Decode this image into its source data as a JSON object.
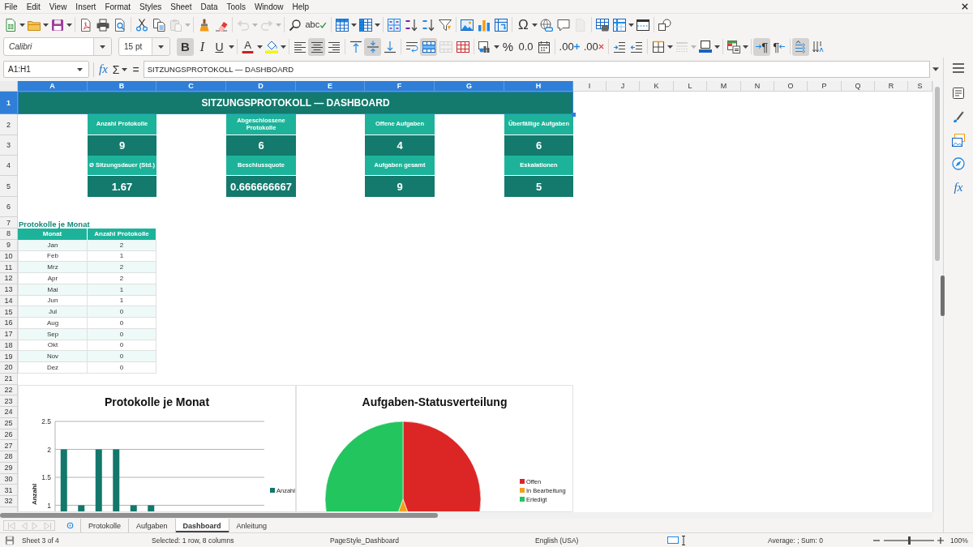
{
  "menu": [
    "File",
    "Edit",
    "View",
    "Insert",
    "Format",
    "Styles",
    "Sheet",
    "Data",
    "Tools",
    "Window",
    "Help"
  ],
  "toolbars": [
    {
      "items": [
        {
          "kind": "dropdown",
          "pressed": false,
          "disabled": false
        },
        {
          "kind": "dropdown",
          "pressed": false,
          "disabled": false
        },
        {
          "kind": "dropdown",
          "pressed": false,
          "disabled": false
        },
        {
          "kind": "separator"
        },
        {
          "kind": "button",
          "pressed": false,
          "disabled": false
        },
        {
          "kind": "button",
          "pressed": false,
          "disabled": false
        },
        {
          "kind": "button",
          "pressed": false,
          "disabled": false
        },
        {
          "kind": "separator"
        },
        {
          "kind": "button",
          "pressed": false,
          "disabled": false
        },
        {
          "kind": "button",
          "pressed": false,
          "disabled": false
        },
        {
          "kind": "dropdown",
          "pressed": false,
          "disabled": true
        },
        {
          "kind": "separator"
        },
        {
          "kind": "button",
          "pressed": false,
          "disabled": false
        },
        {
          "kind": "button",
          "pressed": false,
          "disabled": false
        },
        {
          "kind": "separator"
        },
        {
          "kind": "dropdown",
          "pressed": false,
          "disabled": true
        },
        {
          "kind": "dropdown",
          "pressed": false,
          "disabled": true
        },
        {
          "kind": "separator"
        },
        {
          "kind": "button",
          "pressed": false,
          "disabled": false
        },
        {
          "kind": "button",
          "label": "abc",
          "pressed": false,
          "disabled": false
        },
        {
          "kind": "separator"
        },
        {
          "kind": "dropdown",
          "pressed": false,
          "disabled": false
        },
        {
          "kind": "dropdown",
          "pressed": false,
          "disabled": false
        },
        {
          "kind": "separator"
        },
        {
          "kind": "button",
          "pressed": false,
          "disabled": false
        },
        {
          "kind": "button",
          "pressed": false,
          "disabled": false
        },
        {
          "kind": "button",
          "pressed": false,
          "disabled": false
        },
        {
          "kind": "button",
          "pressed": false,
          "disabled": false
        },
        {
          "kind": "separator"
        },
        {
          "kind": "button",
          "pressed": false,
          "disabled": false
        },
        {
          "kind": "button",
          "pressed": false,
          "disabled": false
        },
        {
          "kind": "button",
          "pressed": false,
          "disabled": false
        },
        {
          "kind": "separator"
        },
        {
          "kind": "dropdown",
          "label": "Ω",
          "pressed": false,
          "disabled": false
        },
        {
          "kind": "button",
          "pressed": false,
          "disabled": false
        },
        {
          "kind": "button",
          "pressed": false,
          "disabled": false
        },
        {
          "kind": "button",
          "pressed": false,
          "disabled": true
        },
        {
          "kind": "separator"
        },
        {
          "kind": "button",
          "pressed": false,
          "disabled": false
        },
        {
          "kind": "dropdown",
          "pressed": false,
          "disabled": false
        },
        {
          "kind": "button",
          "pressed": false,
          "disabled": false
        },
        {
          "kind": "separator"
        },
        {
          "kind": "button",
          "pressed": false,
          "disabled": false
        }
      ]
    },
    {
      "items": [
        {
          "kind": "fontbox",
          "value": "Calibri"
        },
        {
          "kind": "sizebox",
          "value": "15 pt"
        },
        {
          "kind": "button",
          "label": "B",
          "pressed": true,
          "disabled": false
        },
        {
          "kind": "button",
          "label": "I",
          "pressed": false,
          "disabled": false
        },
        {
          "kind": "dropdown",
          "label": "U",
          "pressed": false,
          "disabled": false
        },
        {
          "kind": "separator"
        },
        {
          "kind": "dropdown",
          "label": "A",
          "pressed": false,
          "disabled": false
        },
        {
          "kind": "dropdown",
          "pressed": false,
          "disabled": false
        },
        {
          "kind": "separator"
        },
        {
          "kind": "button",
          "pressed": false,
          "disabled": false
        },
        {
          "kind": "button",
          "pressed": true,
          "disabled": false
        },
        {
          "kind": "button",
          "pressed": false,
          "disabled": false
        },
        {
          "kind": "separator"
        },
        {
          "kind": "button",
          "pressed": false,
          "disabled": false
        },
        {
          "kind": "button",
          "pressed": true,
          "disabled": false
        },
        {
          "kind": "button",
          "pressed": false,
          "disabled": false
        },
        {
          "kind": "separator"
        },
        {
          "kind": "button",
          "pressed": false,
          "disabled": false
        },
        {
          "kind": "button",
          "pressed": true,
          "disabled": false
        },
        {
          "kind": "button",
          "pressed": false,
          "disabled": true
        },
        {
          "kind": "button",
          "pressed": false,
          "disabled": false
        },
        {
          "kind": "separator"
        },
        {
          "kind": "dropdown",
          "pressed": false,
          "disabled": false
        },
        {
          "kind": "button",
          "label": "%",
          "pressed": false,
          "disabled": false
        },
        {
          "kind": "button",
          "label": "0.0",
          "pressed": false,
          "disabled": false
        },
        {
          "kind": "button",
          "pressed": false,
          "disabled": false
        },
        {
          "kind": "separator"
        },
        {
          "kind": "button",
          "label": ".00",
          "pressed": false,
          "disabled": false
        },
        {
          "kind": "button",
          "label": ".00",
          "pressed": false,
          "disabled": false
        },
        {
          "kind": "separator"
        },
        {
          "kind": "button",
          "pressed": false,
          "disabled": false
        },
        {
          "kind": "button",
          "pressed": false,
          "disabled": false
        },
        {
          "kind": "separator"
        },
        {
          "kind": "dropdown",
          "pressed": false,
          "disabled": false
        },
        {
          "kind": "dropdown",
          "pressed": false,
          "disabled": true
        },
        {
          "kind": "dropdown",
          "pressed": false,
          "disabled": false
        },
        {
          "kind": "separator"
        },
        {
          "kind": "dropdown",
          "pressed": false,
          "disabled": false
        },
        {
          "kind": "separator"
        },
        {
          "kind": "button",
          "label": "¶",
          "pressed": true,
          "disabled": false
        },
        {
          "kind": "button",
          "label": "¶",
          "pressed": false,
          "disabled": false
        },
        {
          "kind": "separator"
        },
        {
          "kind": "button",
          "pressed": true,
          "disabled": false
        },
        {
          "kind": "button",
          "pressed": false,
          "disabled": false
        }
      ]
    }
  ],
  "formula_bar": {
    "name_box": "A1:H1",
    "wizard": "fx",
    "sum": "Σ",
    "equals": "=",
    "value": "SITZUNGSPROTOKOLL — DASHBOARD"
  },
  "sheet": {
    "columns": [
      {
        "label": "A",
        "selected": true
      },
      {
        "label": "B",
        "selected": true
      },
      {
        "label": "C",
        "selected": true
      },
      {
        "label": "D",
        "selected": true
      },
      {
        "label": "E",
        "selected": true
      },
      {
        "label": "F",
        "selected": true
      },
      {
        "label": "G",
        "selected": true
      },
      {
        "label": "H",
        "selected": true
      },
      {
        "label": "I",
        "selected": false
      },
      {
        "label": "J",
        "selected": false
      },
      {
        "label": "K",
        "selected": false
      },
      {
        "label": "L",
        "selected": false
      },
      {
        "label": "M",
        "selected": false
      },
      {
        "label": "N",
        "selected": false
      },
      {
        "label": "O",
        "selected": false
      },
      {
        "label": "P",
        "selected": false
      },
      {
        "label": "Q",
        "selected": false
      },
      {
        "label": "R",
        "selected": false
      },
      {
        "label": "S",
        "selected": false
      }
    ],
    "rows": [
      {
        "label": "1",
        "selected": true
      },
      {
        "label": "2",
        "selected": false
      },
      {
        "label": "3",
        "selected": false
      },
      {
        "label": "4",
        "selected": false
      },
      {
        "label": "5",
        "selected": false
      },
      {
        "label": "6",
        "selected": false
      },
      {
        "label": "7",
        "selected": false
      },
      {
        "label": "8",
        "selected": false
      },
      {
        "label": "9",
        "selected": false
      },
      {
        "label": "10",
        "selected": false
      },
      {
        "label": "11",
        "selected": false
      },
      {
        "label": "12",
        "selected": false
      },
      {
        "label": "13",
        "selected": false
      },
      {
        "label": "14",
        "selected": false
      },
      {
        "label": "15",
        "selected": false
      },
      {
        "label": "16",
        "selected": false
      },
      {
        "label": "17",
        "selected": false
      },
      {
        "label": "18",
        "selected": false
      },
      {
        "label": "19",
        "selected": false
      },
      {
        "label": "20",
        "selected": false
      },
      {
        "label": "21",
        "selected": false
      },
      {
        "label": "22",
        "selected": false
      },
      {
        "label": "23",
        "selected": false
      },
      {
        "label": "24",
        "selected": false
      },
      {
        "label": "25",
        "selected": false
      },
      {
        "label": "26",
        "selected": false
      },
      {
        "label": "27",
        "selected": false
      },
      {
        "label": "28",
        "selected": false
      },
      {
        "label": "29",
        "selected": false
      },
      {
        "label": "30",
        "selected": false
      },
      {
        "label": "31",
        "selected": false
      },
      {
        "label": "32",
        "selected": false
      }
    ],
    "title": {
      "text": "SITZUNGSPROTOKOLL — DASHBOARD",
      "selected": true
    },
    "kpis": [
      {
        "label": "Anzahl Protokolle",
        "value": "9"
      },
      {
        "label": "Abgeschlossene Protokolle",
        "value": "6"
      },
      {
        "label": "Offene Aufgaben",
        "value": "4"
      },
      {
        "label": "Überfällige Aufgaben",
        "value": "6"
      },
      {
        "label": "Ø Sitzungsdauer (Std.)",
        "value": "1.67"
      },
      {
        "label": "Beschlussquote",
        "value": "0.666666667"
      },
      {
        "label": "Aufgaben gesamt",
        "value": "9"
      },
      {
        "label": "Eskalationen",
        "value": "5"
      }
    ],
    "section_title": "Protokolle je Monat",
    "table": {
      "columns": [
        "Monat",
        "Anzahl Protokolle"
      ],
      "rows": [
        [
          "Jan",
          "2"
        ],
        [
          "Feb",
          "1"
        ],
        [
          "Mrz",
          "2"
        ],
        [
          "Apr",
          "2"
        ],
        [
          "Mai",
          "1"
        ],
        [
          "Jun",
          "1"
        ],
        [
          "Jul",
          "0"
        ],
        [
          "Aug",
          "0"
        ],
        [
          "Sep",
          "0"
        ],
        [
          "Okt",
          "0"
        ],
        [
          "Nov",
          "0"
        ],
        [
          "Dez",
          "0"
        ]
      ]
    },
    "charts": [
      {
        "chart_data": {
          "type": "bar",
          "title": "Protokolle je Monat",
          "ylabel": "Anzahl",
          "grid": true,
          "legend": "right",
          "series": [
            {
              "name": "Anzahl",
              "color": "#13776b",
              "values": [
                2,
                1,
                2,
                2,
                1,
                1,
                0,
                0,
                0,
                0,
                0,
                0
              ]
            }
          ],
          "ylim": [
            0,
            2.5
          ],
          "yticks": [
            1,
            1.5,
            2,
            2.5
          ]
        }
      },
      {
        "chart_data": {
          "type": "pie",
          "title": "Aufgaben-Statusverteilung",
          "legend": "right",
          "categories": [
            "Offen",
            "In Bearbeitung",
            "Erledigt"
          ],
          "values": [
            44.4,
            11.2,
            44.4
          ],
          "colors": [
            "#dc2626",
            "#f0a020",
            "#22c55e"
          ]
        }
      }
    ]
  },
  "sidebar": {
    "functions": "fx"
  },
  "sheet_nav": [
    {
      "disabled": true
    },
    {
      "disabled": true
    },
    {
      "disabled": true
    },
    {
      "disabled": true
    }
  ],
  "sheet_tabs": [
    {
      "label": "Protokolle",
      "selected": false
    },
    {
      "label": "Aufgaben",
      "selected": false
    },
    {
      "label": "Dashboard",
      "selected": true
    },
    {
      "label": "Anleitung",
      "selected": false
    }
  ],
  "status_bar": {
    "sheet": "Sheet 3 of 4",
    "selection": "Selected: 1 row, 8 columns",
    "page_style": "PageStyle_Dashboard",
    "language": "English (USA)",
    "summary": "Average: ; Sum: 0",
    "zoom_slider": {
      "level": 0.5
    },
    "zoom": "100%"
  }
}
